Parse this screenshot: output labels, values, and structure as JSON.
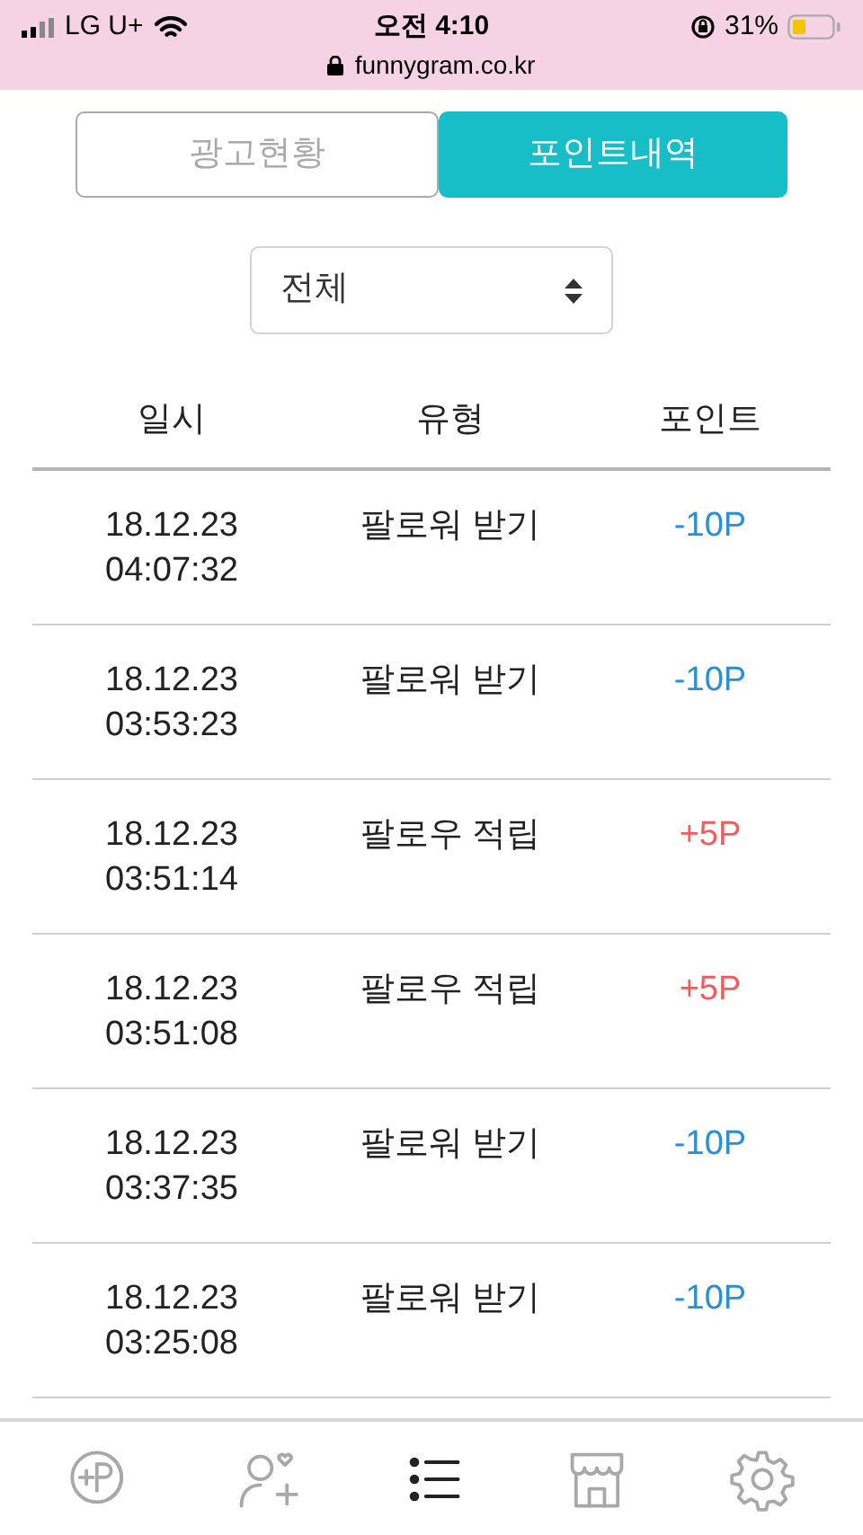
{
  "status_bar": {
    "carrier": "LG U+",
    "time": "오전 4:10",
    "battery_percent": "31%",
    "url": "funnygram.co.kr"
  },
  "tabs": [
    {
      "label": "광고현황",
      "selected": false
    },
    {
      "label": "포인트내역",
      "selected": true
    }
  ],
  "filter": {
    "value": "전체"
  },
  "table": {
    "columns": [
      "일시",
      "유형",
      "포인트"
    ],
    "rows": [
      {
        "date": "18.12.23",
        "time": "04:07:32",
        "type": "팔로워 받기",
        "points": "-10P",
        "color": "#2a8fd4"
      },
      {
        "date": "18.12.23",
        "time": "03:53:23",
        "type": "팔로워 받기",
        "points": "-10P",
        "color": "#2a8fd4"
      },
      {
        "date": "18.12.23",
        "time": "03:51:14",
        "type": "팔로우 적립",
        "points": "+5P",
        "color": "#f25c5c"
      },
      {
        "date": "18.12.23",
        "time": "03:51:08",
        "type": "팔로우 적립",
        "points": "+5P",
        "color": "#f25c5c"
      },
      {
        "date": "18.12.23",
        "time": "03:37:35",
        "type": "팔로워 받기",
        "points": "-10P",
        "color": "#2a8fd4"
      },
      {
        "date": "18.12.23",
        "time": "03:25:08",
        "type": "팔로워 받기",
        "points": "-10P",
        "color": "#2a8fd4"
      }
    ]
  },
  "bottom_nav": [
    {
      "kind": "points",
      "selected": false
    },
    {
      "kind": "follow",
      "selected": false
    },
    {
      "kind": "list",
      "selected": true
    },
    {
      "kind": "shop",
      "selected": false
    },
    {
      "kind": "settings",
      "selected": false
    }
  ]
}
